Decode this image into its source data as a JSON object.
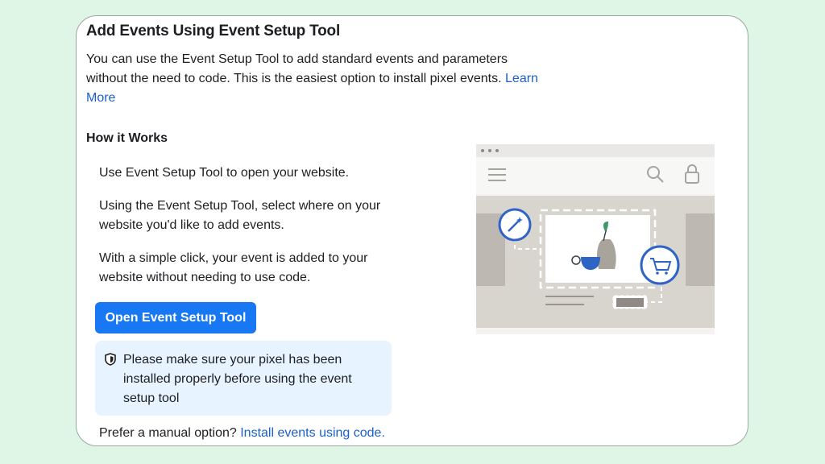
{
  "title": "Add Events Using Event Setup Tool",
  "intro": {
    "text": "You can use the Event Setup Tool to add standard events and parameters without the need to code. This is the easiest option to install pixel events.",
    "link": "Learn More"
  },
  "how_it_works": {
    "heading": "How it Works",
    "steps": [
      "Use Event Setup Tool to open your website.",
      "Using the Event Setup Tool, select where on your website you'd like to add events.",
      "With a simple click, your event is added to your website without needing to use code."
    ]
  },
  "open_button": "Open Event Setup Tool",
  "notice": {
    "icon": "shield-icon",
    "text": "Please make sure your pixel has been installed properly before using the event setup tool"
  },
  "manual": {
    "text": "Prefer a manual option?",
    "link": "Install events using code."
  },
  "colors": {
    "background": "#dff6e6",
    "accent": "#1877f2",
    "link": "#1a5fd0",
    "notice_bg": "#e7f3ff"
  }
}
